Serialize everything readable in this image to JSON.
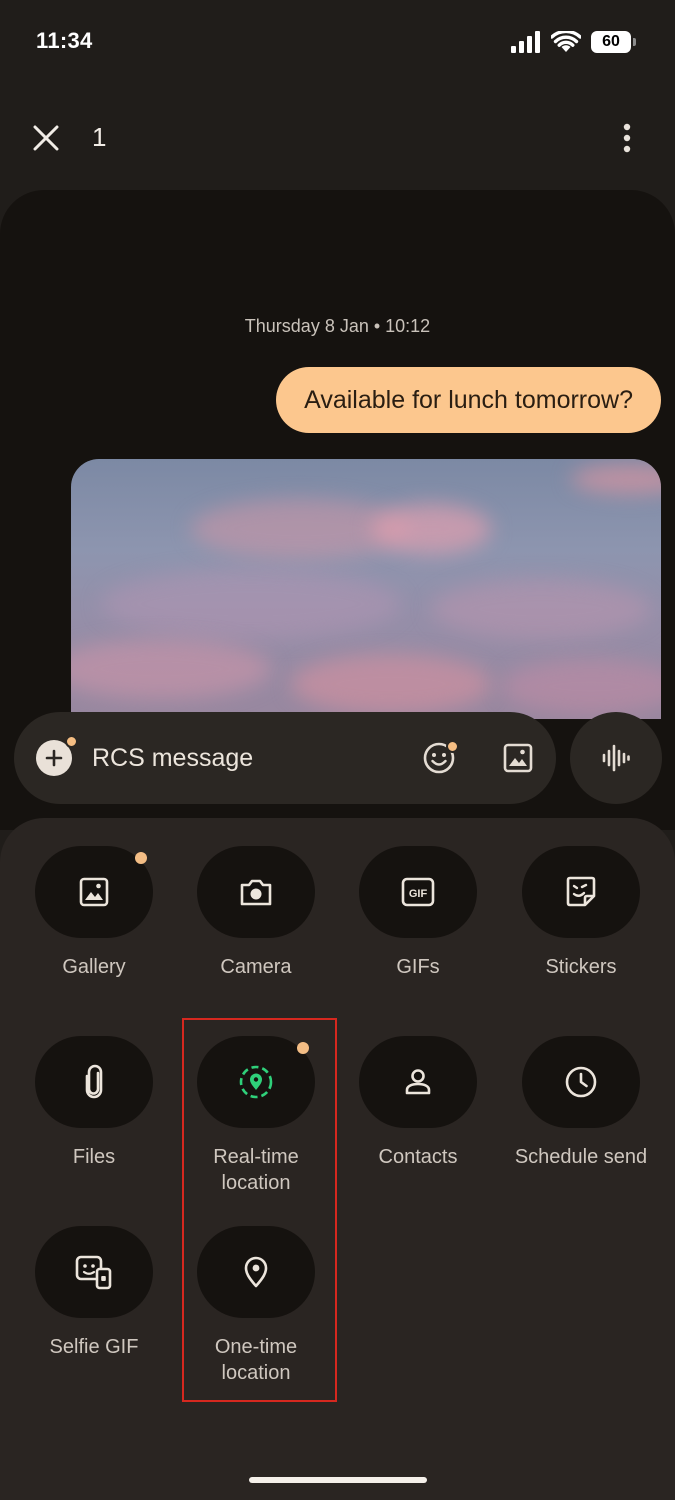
{
  "status_bar": {
    "time": "11:34",
    "battery": "60"
  },
  "top_bar": {
    "selection_count": "1"
  },
  "conversation": {
    "timestamp": "Thursday 8 Jan • 10:12",
    "outgoing_message": "Available for lunch tomorrow?"
  },
  "compose": {
    "placeholder": "RCS message"
  },
  "attachments": {
    "items": [
      {
        "label": "Gallery",
        "icon": "image-icon"
      },
      {
        "label": "Camera",
        "icon": "camera-icon"
      },
      {
        "label": "GIFs",
        "icon": "gif-icon"
      },
      {
        "label": "Stickers",
        "icon": "sticker-icon"
      },
      {
        "label": "Files",
        "icon": "paperclip-icon"
      },
      {
        "label": "Real-time\nlocation",
        "icon": "live-location-icon"
      },
      {
        "label": "Contacts",
        "icon": "person-icon"
      },
      {
        "label": "Schedule send",
        "icon": "clock-icon"
      },
      {
        "label": "Selfie GIF",
        "icon": "selfie-gif-icon"
      },
      {
        "label": "One-time\nlocation",
        "icon": "location-pin-icon"
      }
    ]
  },
  "colors": {
    "background": "#201d1a",
    "conversation_bg": "#15120f",
    "sheet_bg": "#2a2522",
    "bubble": "#fcc78e",
    "accent_dot": "#f3bd85",
    "live_location_green": "#2fd07a",
    "highlight_box": "#d6281f"
  }
}
